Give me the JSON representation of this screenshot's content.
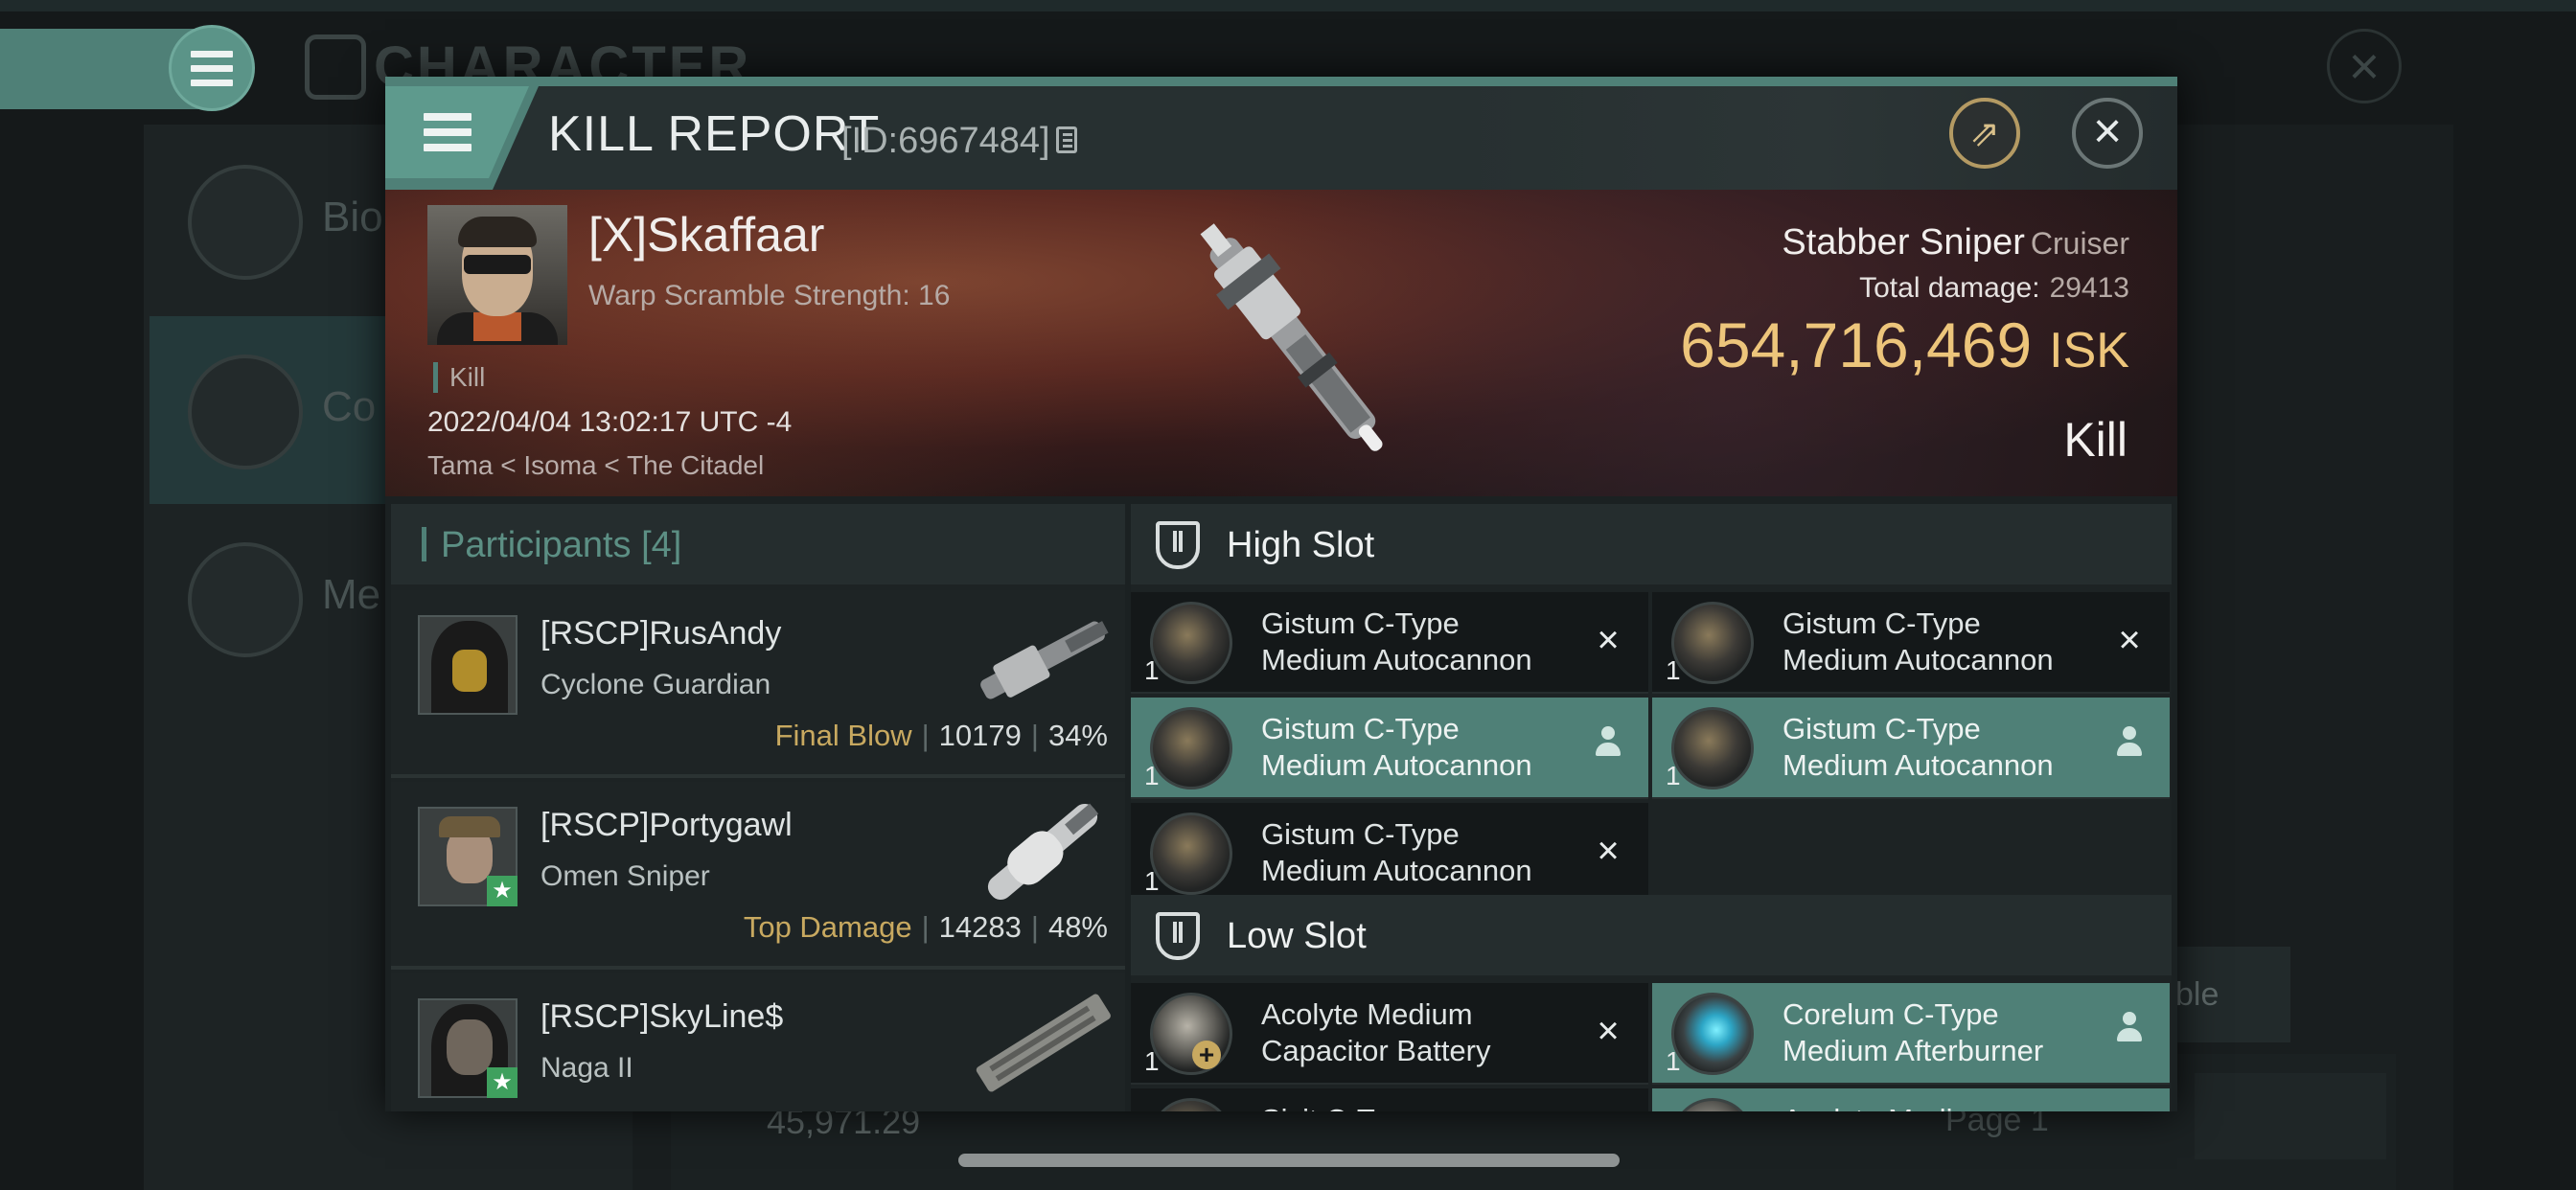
{
  "background": {
    "title": "CHARACTER",
    "side_items": [
      "Bio",
      "Co",
      "Me"
    ],
    "isk_value": "45,971.29",
    "page_label": "Page 1",
    "right_partial": "ble"
  },
  "report": {
    "title": "KILL REPORT",
    "id": "[ID:6967484]",
    "victim": {
      "name": "[X]Skaffaar",
      "subtitle": "Warp Scramble Strength: 16",
      "kill_tag": "Kill",
      "datetime": "2022/04/04 13:02:17 UTC -4",
      "location": "Tama < Isoma < The Citadel"
    },
    "ship": {
      "name": "Stabber Sniper",
      "class": "Cruiser",
      "total_damage_label": "Total damage:",
      "total_damage": "29413",
      "isk_value": "654,716,469",
      "isk_unit": "ISK",
      "result": "Kill"
    }
  },
  "participants": {
    "label": "Participants",
    "count": "[4]",
    "rows": [
      {
        "name": "[RSCP]RusAndy",
        "ship": "Cyclone Guardian",
        "tag": "Final Blow",
        "damage": "10179",
        "percent": "34%"
      },
      {
        "name": "[RSCP]Portygawl",
        "ship": "Omen Sniper",
        "tag": "Top Damage",
        "damage": "14283",
        "percent": "48%"
      },
      {
        "name": "[RSCP]SkyLine$",
        "ship": "Naga II",
        "tag": "",
        "damage": "",
        "percent": ""
      }
    ]
  },
  "fitting": {
    "high_slot_label": "High Slot",
    "low_slot_label": "Low Slot",
    "high": [
      {
        "name1": "Gistum C-Type",
        "name2": "Medium Autocannon",
        "qty": "1",
        "status": "destroyed"
      },
      {
        "name1": "Gistum C-Type",
        "name2": "Medium Autocannon",
        "qty": "1",
        "status": "destroyed"
      },
      {
        "name1": "Gistum C-Type",
        "name2": "Medium Autocannon",
        "qty": "1",
        "status": "dropped"
      },
      {
        "name1": "Gistum C-Type",
        "name2": "Medium Autocannon",
        "qty": "1",
        "status": "dropped"
      },
      {
        "name1": "Gistum C-Type",
        "name2": "Medium Autocannon",
        "qty": "1",
        "status": "destroyed"
      }
    ],
    "low": [
      {
        "name1": "Acolyte Medium",
        "name2": "Capacitor Battery",
        "qty": "1",
        "status": "destroyed"
      },
      {
        "name1": "Corelum C-Type",
        "name2": "Medium Afterburner",
        "qty": "1",
        "status": "dropped"
      },
      {
        "name1": "Sixit C-Type...",
        "name2": "",
        "qty": "",
        "status": "destroyed"
      },
      {
        "name1": "Acolyte Medium",
        "name2": "",
        "qty": "",
        "status": "dropped"
      }
    ]
  },
  "icons": {
    "destroyed": "close-x",
    "dropped": "person-icon"
  },
  "colors": {
    "accent": "#4f8077",
    "isk": "#edc57b",
    "tag": "#c8a960",
    "star": "#3fa05e"
  }
}
